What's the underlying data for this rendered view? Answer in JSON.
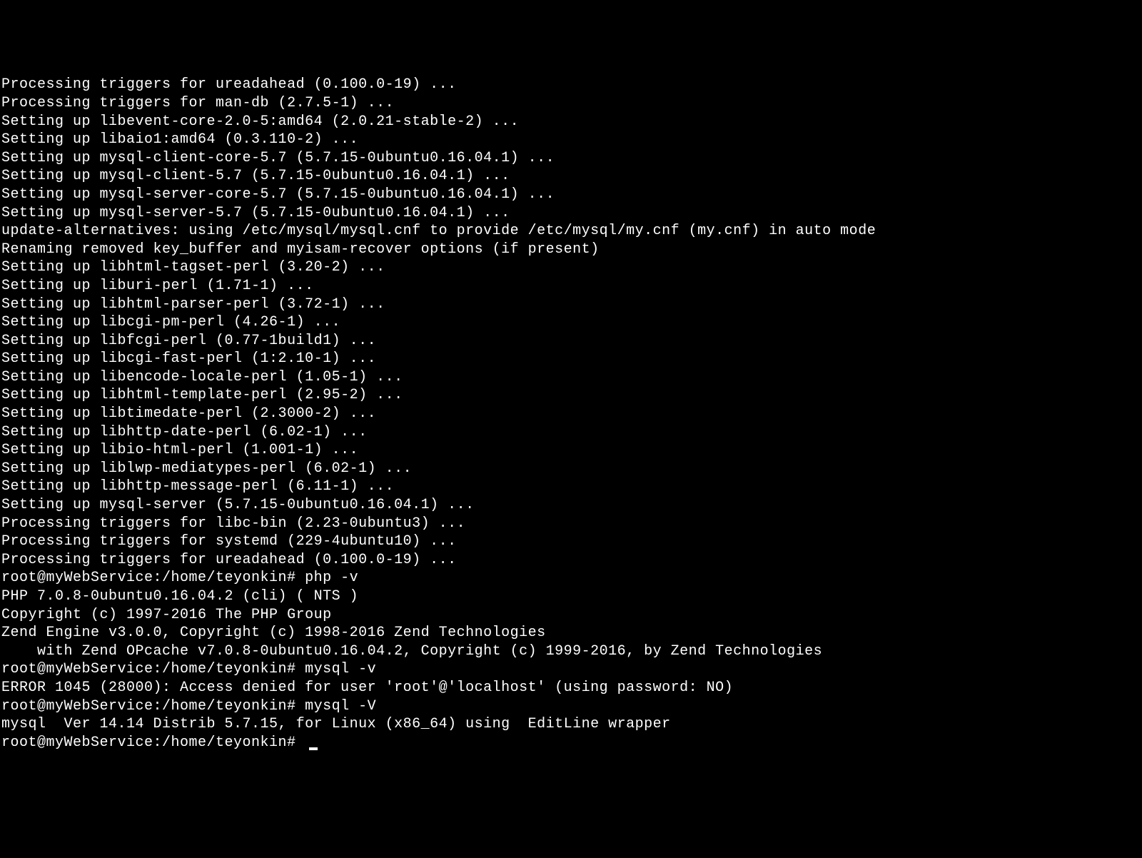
{
  "terminal": {
    "lines": [
      "Processing triggers for ureadahead (0.100.0-19) ...",
      "Processing triggers for man-db (2.7.5-1) ...",
      "Setting up libevent-core-2.0-5:amd64 (2.0.21-stable-2) ...",
      "Setting up libaio1:amd64 (0.3.110-2) ...",
      "Setting up mysql-client-core-5.7 (5.7.15-0ubuntu0.16.04.1) ...",
      "Setting up mysql-client-5.7 (5.7.15-0ubuntu0.16.04.1) ...",
      "Setting up mysql-server-core-5.7 (5.7.15-0ubuntu0.16.04.1) ...",
      "Setting up mysql-server-5.7 (5.7.15-0ubuntu0.16.04.1) ...",
      "update-alternatives: using /etc/mysql/mysql.cnf to provide /etc/mysql/my.cnf (my.cnf) in auto mode",
      "Renaming removed key_buffer and myisam-recover options (if present)",
      "Setting up libhtml-tagset-perl (3.20-2) ...",
      "Setting up liburi-perl (1.71-1) ...",
      "Setting up libhtml-parser-perl (3.72-1) ...",
      "Setting up libcgi-pm-perl (4.26-1) ...",
      "Setting up libfcgi-perl (0.77-1build1) ...",
      "Setting up libcgi-fast-perl (1:2.10-1) ...",
      "Setting up libencode-locale-perl (1.05-1) ...",
      "Setting up libhtml-template-perl (2.95-2) ...",
      "Setting up libtimedate-perl (2.3000-2) ...",
      "Setting up libhttp-date-perl (6.02-1) ...",
      "Setting up libio-html-perl (1.001-1) ...",
      "Setting up liblwp-mediatypes-perl (6.02-1) ...",
      "Setting up libhttp-message-perl (6.11-1) ...",
      "Setting up mysql-server (5.7.15-0ubuntu0.16.04.1) ...",
      "Processing triggers for libc-bin (2.23-0ubuntu3) ...",
      "Processing triggers for systemd (229-4ubuntu10) ...",
      "Processing triggers for ureadahead (0.100.0-19) ...",
      "root@myWebService:/home/teyonkin# php -v",
      "PHP 7.0.8-0ubuntu0.16.04.2 (cli) ( NTS )",
      "Copyright (c) 1997-2016 The PHP Group",
      "Zend Engine v3.0.0, Copyright (c) 1998-2016 Zend Technologies",
      "    with Zend OPcache v7.0.8-0ubuntu0.16.04.2, Copyright (c) 1999-2016, by Zend Technologies",
      "root@myWebService:/home/teyonkin# mysql -v",
      "ERROR 1045 (28000): Access denied for user 'root'@'localhost' (using password: NO)",
      "root@myWebService:/home/teyonkin# mysql -V",
      "mysql  Ver 14.14 Distrib 5.7.15, for Linux (x86_64) using  EditLine wrapper",
      "root@myWebService:/home/teyonkin# "
    ]
  }
}
